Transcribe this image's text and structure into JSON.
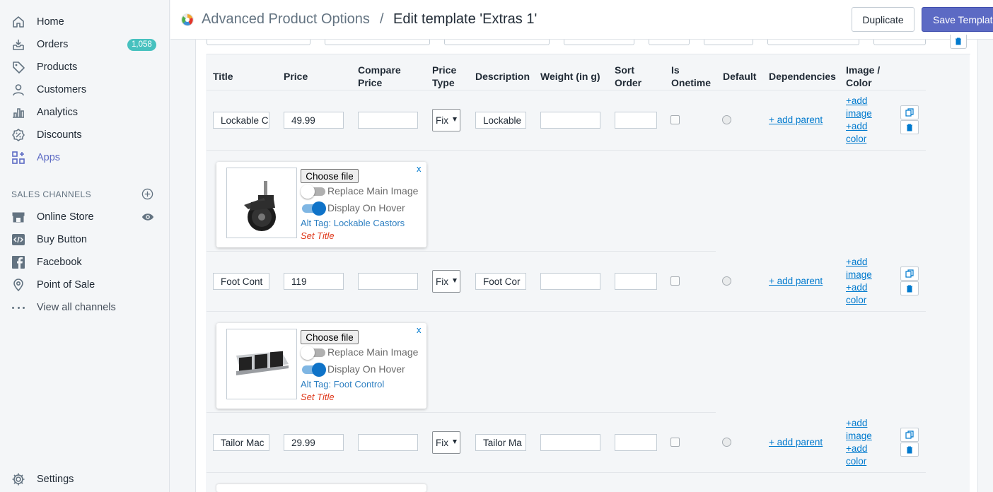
{
  "sidebar": {
    "nav": [
      {
        "label": "Home",
        "icon": "home-icon"
      },
      {
        "label": "Orders",
        "icon": "orders-icon",
        "badge": "1,058"
      },
      {
        "label": "Products",
        "icon": "tag-icon"
      },
      {
        "label": "Customers",
        "icon": "person-icon"
      },
      {
        "label": "Analytics",
        "icon": "bar-chart-icon"
      },
      {
        "label": "Discounts",
        "icon": "discount-icon"
      },
      {
        "label": "Apps",
        "icon": "apps-icon",
        "active": true
      }
    ],
    "sales_channels_title": "SALES CHANNELS",
    "channels": [
      {
        "label": "Online Store",
        "icon": "store-icon"
      },
      {
        "label": "Buy Button",
        "icon": "code-icon"
      },
      {
        "label": "Facebook",
        "icon": "facebook-icon"
      },
      {
        "label": "Point of Sale",
        "icon": "location-icon"
      }
    ],
    "view_all": "View all channels",
    "settings": "Settings"
  },
  "header": {
    "app_name": "Advanced Product Options",
    "separator": "/",
    "title": "Edit template 'Extras 1'",
    "duplicate_label": "Duplicate",
    "save_label": "Save Template"
  },
  "table": {
    "headers": {
      "title": "Title",
      "price": "Price",
      "compare_price_1": "Compare",
      "compare_price_2": "Price",
      "price_type_1": "Price",
      "price_type_2": "Type",
      "description": "Description",
      "weight": "Weight (in g)",
      "sort_order_1": "Sort",
      "sort_order_2": "Order",
      "is_onetime_1": "Is",
      "is_onetime_2": "Onetime",
      "default": "Default",
      "dependencies": "Dependencies",
      "image_color_1": "Image /",
      "image_color_2": "Color"
    },
    "rows": [
      {
        "title": "Lockable C",
        "price": "49.99",
        "compare_price": "",
        "price_type": "Fix",
        "description": "Lockable",
        "weight": "",
        "sort_order": "",
        "add_parent": "+ add parent",
        "add_image_1": "+add",
        "add_image_2": "image",
        "add_color_1": "+add",
        "add_color_2": "color",
        "image": {
          "choose_file": "Choose file",
          "close": "x",
          "replace_main": "Replace Main Image",
          "replace_main_on": false,
          "display_hover": "Display On Hover",
          "display_hover_on": true,
          "alt_tag": "Alt Tag: Lockable Castors",
          "set_title": "Set Title",
          "thumb": "castor-wheel-image"
        }
      },
      {
        "title": "Foot Cont",
        "price": "119",
        "compare_price": "",
        "price_type": "Fix",
        "description": "Foot Cor",
        "weight": "",
        "sort_order": "",
        "add_parent": "+ add parent",
        "add_image_1": "+add",
        "add_image_2": "image",
        "add_color_1": "+add",
        "add_color_2": "color",
        "image": {
          "choose_file": "Choose file",
          "close": "x",
          "replace_main": "Replace Main Image",
          "replace_main_on": false,
          "display_hover": "Display On Hover",
          "display_hover_on": true,
          "alt_tag": "Alt Tag: Foot Control",
          "set_title": "Set Title",
          "thumb": "foot-pedal-image"
        }
      },
      {
        "title": "Tailor Mac",
        "price": "29.99",
        "compare_price": "",
        "price_type": "Fix",
        "description": "Tailor Ma",
        "weight": "",
        "sort_order": "",
        "add_parent": "+ add parent",
        "add_image_1": "+add",
        "add_image_2": "image",
        "add_color_1": "+add",
        "add_color_2": "color"
      }
    ]
  },
  "colors": {
    "accent": "#5c6ac4",
    "badge": "#47c1bf",
    "link": "#007ace",
    "toggle_on": "#0f73c8",
    "set_title": "#de3618"
  }
}
